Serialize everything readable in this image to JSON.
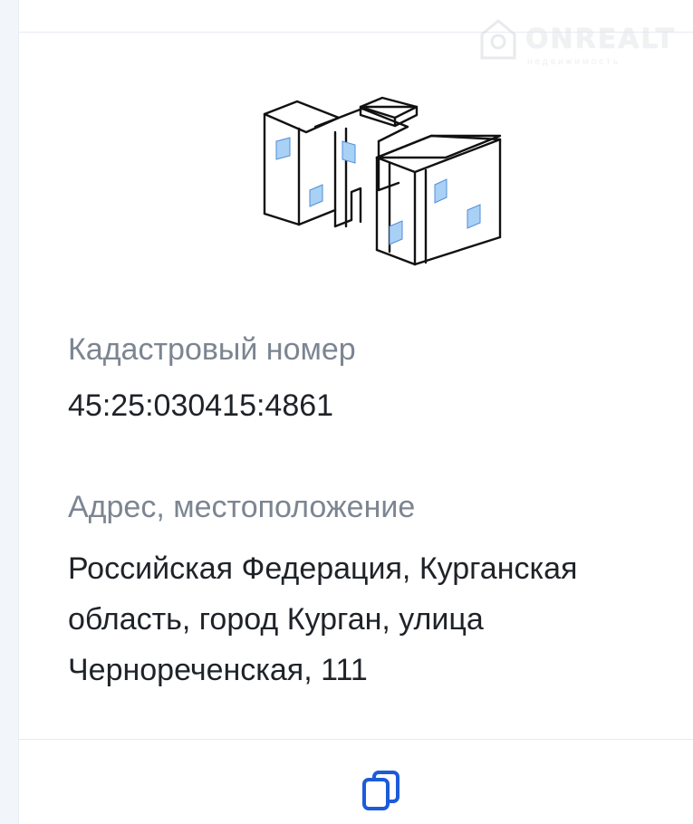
{
  "watermark": {
    "brand": "ONREALT",
    "subtitle": "недвижимость"
  },
  "cadastral": {
    "label": "Кадастровый номер",
    "value": "45:25:030415:4861"
  },
  "address": {
    "label": "Адрес, местоположение",
    "line1": "Российская Федерация, Курганская",
    "line2": "область, город Курган, улица",
    "line3": "Чернореченская, 111"
  },
  "icons": {
    "building": "building-illustration-icon",
    "copy": "copy-icon"
  },
  "colors": {
    "accent": "#1c5bd9",
    "window_fill": "#a9d1f5",
    "label_gray": "#7c8591",
    "text": "#1f2328"
  }
}
